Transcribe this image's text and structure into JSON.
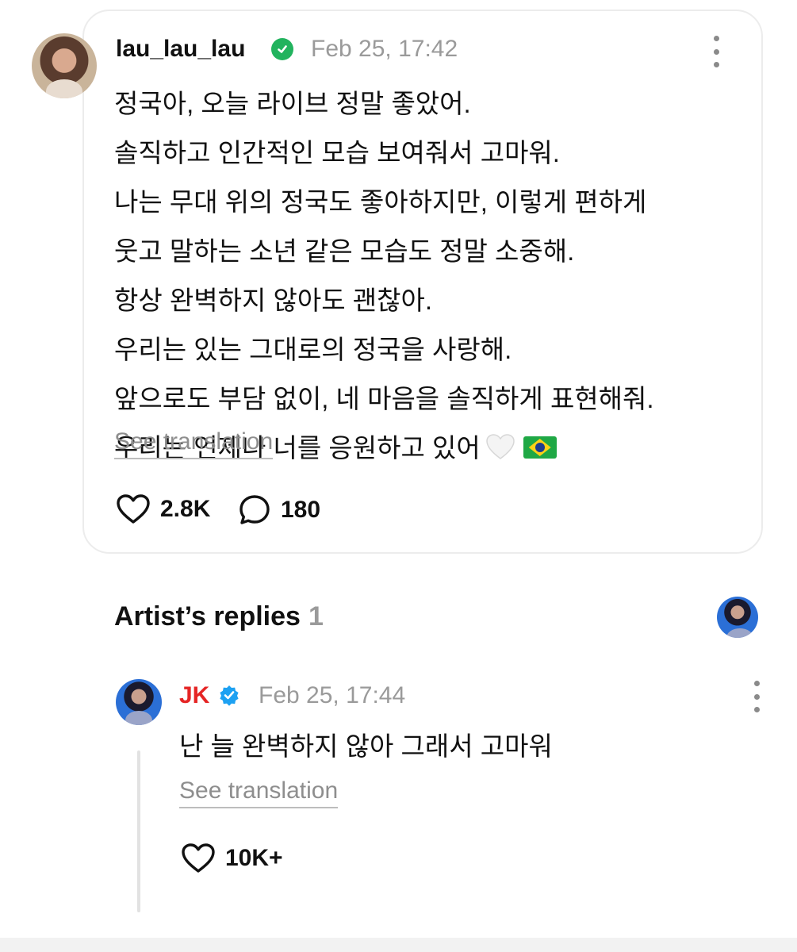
{
  "post": {
    "username": "lau_lau_lau",
    "timestamp": "Feb 25, 17:42",
    "lines": [
      "정국아, 오늘 라이브 정말 좋았어.",
      "솔직하고 인간적인 모습 보여줘서 고마워.",
      "나는 무대 위의 정국도 좋아하지만, 이렇게 편하게",
      "웃고 말하는 소년 같은 모습도 정말 소중해.",
      "항상 완벽하지 않아도 괜찮아.",
      "우리는 있는 그대로의 정국을 사랑해.",
      "앞으로도 부담 없이, 네 마음을 솔직하게 표현해줘.",
      "우리는 언제나 너를 응원하고 있어"
    ],
    "emojis": [
      "white-heart-icon",
      "brazil-flag-icon"
    ],
    "see_translation": "See translation",
    "likes": "2.8K",
    "comments": "180"
  },
  "replies_section": {
    "title": "Artist’s replies",
    "count": "1"
  },
  "reply": {
    "username": "JK",
    "timestamp": "Feb 25, 17:44",
    "text": "난 늘 완벽하지 않아 그래서 고마워",
    "see_translation": "See translation",
    "likes": "10K+"
  },
  "colors": {
    "artist_name": "#e52525",
    "verified_green": "#22b35e",
    "verified_blue": "#1da1f2",
    "muted_text": "#9a9a9a"
  }
}
